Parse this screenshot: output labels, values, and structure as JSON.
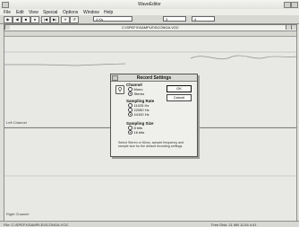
{
  "app": {
    "title": "WaveEditor"
  },
  "menubar": {
    "items": [
      "File",
      "Edit",
      "View",
      "Special",
      "Options",
      "Window",
      "Help"
    ]
  },
  "toolbar": {
    "buttons": [
      "▶",
      "◀",
      "■",
      "●",
      "|◀",
      "▶|",
      "⏸",
      "↺"
    ],
    "field_a": "4 Ks",
    "field_b": "3",
    "field_c": "4"
  },
  "document": {
    "title": "C:\\SPEFX\\SAMPLE\\SCONGA.VOC"
  },
  "channels": {
    "left_label": "Left Channel",
    "right_label": "Right Channel"
  },
  "dialog": {
    "title": "Record Settings",
    "channel_title": "Channel",
    "channel_options": [
      {
        "label": "Mono",
        "selected": false
      },
      {
        "label": "Stereo",
        "selected": true
      }
    ],
    "rate_title": "Sampling Rate",
    "rate_options": [
      {
        "label": "11025 Hz",
        "selected": false
      },
      {
        "label": "22050 Hz",
        "selected": false
      },
      {
        "label": "44100 Hz",
        "selected": true
      }
    ],
    "size_title": "Sampling Size",
    "size_options": [
      {
        "label": "8 bits",
        "selected": false
      },
      {
        "label": "16 bits",
        "selected": true
      }
    ],
    "ok_label": "OK",
    "cancel_label": "Cancel",
    "description": "Select Stereo or Mono, sample frequency and sample size for the default recording settings."
  },
  "statusbar": {
    "left": "File: C:\\SPEFX\\SAMPLE\\SCONGA.VOC",
    "right": "Free Disk: 21 MB  11:54  4:41"
  }
}
